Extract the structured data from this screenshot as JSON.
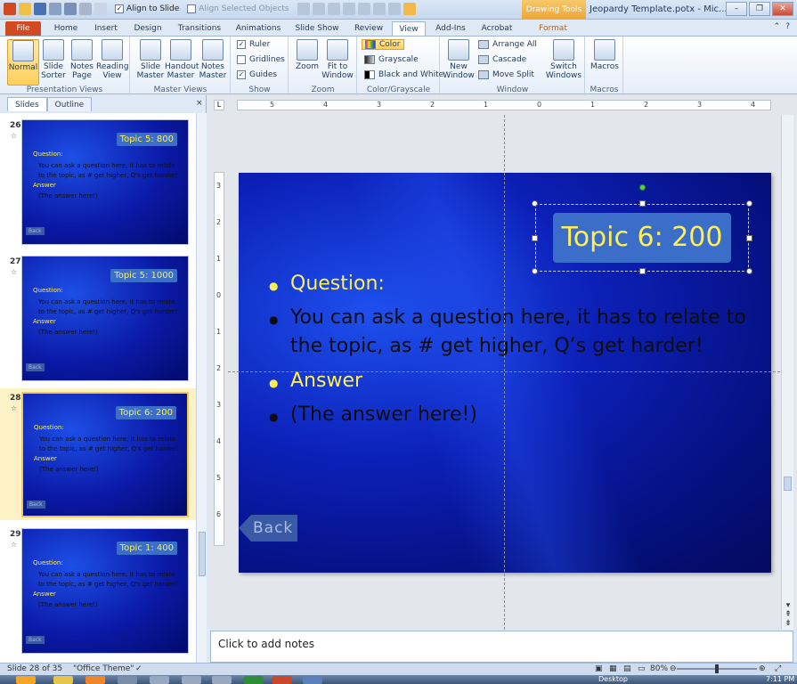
{
  "app": {
    "window_title": "Jeopardy Template.potx - Mic...",
    "contextual_tab_group": "Drawing Tools"
  },
  "qat": {
    "align_to_slide_label": "Align to Slide",
    "align_selected_label": "Align Selected Objects"
  },
  "tabs": [
    "File",
    "Home",
    "Insert",
    "Design",
    "Transitions",
    "Animations",
    "Slide Show",
    "Review",
    "View",
    "Add-Ins",
    "Acrobat",
    "Format"
  ],
  "active_tab": "View",
  "ribbon": {
    "presentation_views": {
      "label": "Presentation Views",
      "buttons": [
        "Normal",
        "Slide Sorter",
        "Notes Page",
        "Reading View"
      ]
    },
    "master_views": {
      "label": "Master Views",
      "buttons": [
        "Slide Master",
        "Handout Master",
        "Notes Master"
      ]
    },
    "show": {
      "label": "Show",
      "items": [
        "Ruler",
        "Gridlines",
        "Guides"
      ],
      "checked": [
        true,
        false,
        true
      ]
    },
    "zoom": {
      "label": "Zoom",
      "buttons": [
        "Zoom",
        "Fit to Window"
      ]
    },
    "color_grayscale": {
      "label": "Color/Grayscale",
      "items": [
        "Color",
        "Grayscale",
        "Black and White"
      ]
    },
    "window": {
      "label": "Window",
      "new_window": "New Window",
      "items": [
        "Arrange All",
        "Cascade",
        "Move Split"
      ],
      "switch_windows": "Switch Windows"
    },
    "macros": {
      "label": "Macros",
      "button": "Macros"
    }
  },
  "left_panel": {
    "tabs": [
      "Slides",
      "Outline"
    ],
    "active_tab": "Slides",
    "close_glyph": "×",
    "thumbnails": [
      {
        "number": "26",
        "title": "Topic 5: 800",
        "selected": false
      },
      {
        "number": "27",
        "title": "Topic 5: 1000",
        "selected": false
      },
      {
        "number": "28",
        "title": "Topic 6: 200",
        "selected": true
      },
      {
        "number": "29",
        "title": "Topic 1: 400",
        "selected": false
      }
    ],
    "thumb_text": {
      "question": "Question:",
      "question_body": "You can ask a question here, it has to relate to the topic, as # get higher, Q's get harder!",
      "answer": "Answer",
      "answer_body": "(The answer here!)",
      "back": "Back"
    }
  },
  "rulers": {
    "horizontal": [
      "5",
      "4",
      "3",
      "2",
      "1",
      "0",
      "1",
      "2",
      "3",
      "4"
    ],
    "vertical": [
      "3",
      "2",
      "1",
      "0",
      "1",
      "2",
      "3",
      "4",
      "5",
      "6"
    ]
  },
  "slide": {
    "title": "Topic 6: 200",
    "question_label": "Question:",
    "question_body_line1": "You can ask a question here, it has to relate to",
    "question_body_line2": "the topic, as # get higher, Q’s get harder!",
    "answer_label": "Answer",
    "answer_body": "(The answer here!)",
    "back_button": "Back",
    "colors": {
      "title_text": "#ffef55",
      "title_fill": "#3a6ec8",
      "background": "#0c20b8"
    }
  },
  "notes": {
    "placeholder": "Click to add notes"
  },
  "status": {
    "slide_info": "Slide 28 of 35",
    "theme": "\"Office Theme\"",
    "zoom": "80%"
  },
  "taskbar": {
    "desktop_label": "Desktop",
    "time": "7:11 PM"
  }
}
